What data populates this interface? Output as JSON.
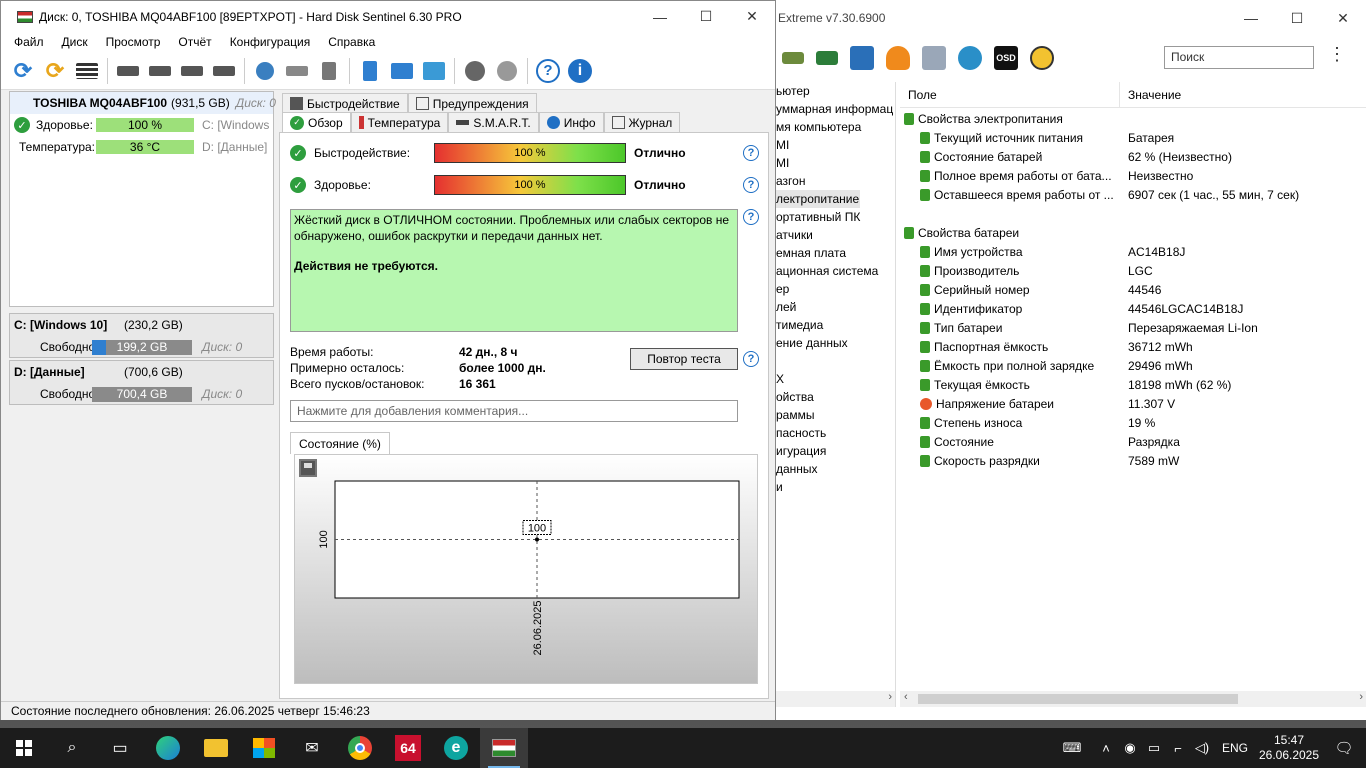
{
  "aida": {
    "title": "Extreme v7.30.6900",
    "search_placeholder": "Поиск",
    "tree": [
      "ьютер",
      "уммарная информац",
      "мя компьютера",
      "MI",
      "MI",
      "азгон",
      "лектропитание",
      "ортативный ПК",
      "атчики",
      "емная плата",
      "ационная система",
      "ер",
      "лей",
      "тимедиа",
      "ение данных",
      "",
      "X",
      "ойства",
      "раммы",
      "пасность",
      "игурация",
      "данных",
      "и"
    ],
    "selected_index": 6,
    "col_field": "Поле",
    "col_value": "Значение",
    "groups": [
      {
        "name": "Свойства электропитания",
        "rows": [
          {
            "k": "Текущий источник питания",
            "v": "Батарея"
          },
          {
            "k": "Состояние батарей",
            "v": "62 % (Неизвестно)"
          },
          {
            "k": "Полное время работы от бата...",
            "v": "Неизвестно"
          },
          {
            "k": "Оставшееся время работы от ...",
            "v": "6907 сек (1 час., 55 мин, 7 сек)"
          }
        ]
      },
      {
        "name": "Свойства батареи",
        "rows": [
          {
            "k": "Имя устройства",
            "v": "AC14B18J"
          },
          {
            "k": "Производитель",
            "v": "LGC"
          },
          {
            "k": "Серийный номер",
            "v": "44546"
          },
          {
            "k": "Идентификатор",
            "v": "44546LGCAC14B18J"
          },
          {
            "k": "Тип батареи",
            "v": "Перезаряжаемая Li-Ion"
          },
          {
            "k": "Паспортная ёмкость",
            "v": "36712 mWh"
          },
          {
            "k": "Ёмкость при полной зарядке",
            "v": "29496 mWh"
          },
          {
            "k": "Текущая ёмкость",
            "v": "18198 mWh  (62 %)"
          },
          {
            "k": "Напряжение батареи",
            "v": "11.307 V"
          },
          {
            "k": "Степень износа",
            "v": "19 %"
          },
          {
            "k": "Состояние",
            "v": "Разрядка"
          },
          {
            "k": "Скорость разрядки",
            "v": "7589 mW"
          }
        ]
      }
    ]
  },
  "hds": {
    "title": "Диск: 0, TOSHIBA MQ04ABF100 [89EPTXPOT]  -  Hard Disk Sentinel 6.30 PRO",
    "menu": [
      "Файл",
      "Диск",
      "Просмотр",
      "Отчёт",
      "Конфигурация",
      "Справка"
    ],
    "disk": {
      "name": "TOSHIBA MQ04ABF100",
      "size": "(931,5 GB)",
      "index": "Диск: 0",
      "health_label": "Здоровье:",
      "health_value": "100 %",
      "health_drive": "C: [Windows",
      "temp_label": "Температура:",
      "temp_value": "36 °C",
      "temp_drive": "D: [Данные]"
    },
    "volumes": [
      {
        "name": "C: [Windows 10]",
        "size": "(230,2 GB)",
        "free_label": "Свободно",
        "free": "199,2 GB",
        "free_fraction": 0.135,
        "disk": "Диск: 0"
      },
      {
        "name": "D: [Данные]",
        "size": "(700,6 GB)",
        "free_label": "Свободно",
        "free": "700,4 GB",
        "free_fraction": 0.0,
        "disk": "Диск: 0"
      }
    ],
    "tabs_top": [
      "Быстродействие",
      "Предупреждения"
    ],
    "tabs_bottom": [
      "Обзор",
      "Температура",
      "S.M.A.R.T.",
      "Инфо",
      "Журнал"
    ],
    "perf_label": "Быстродействие:",
    "perf_value": "100 %",
    "perf_fraction": 1.0,
    "perf_verdict": "Отлично",
    "health_label": "Здоровье:",
    "health_value": "100 %",
    "health_fraction": 1.0,
    "health_verdict": "Отлично",
    "status_text": "Жёсткий диск в ОТЛИЧНОМ состоянии. Проблемных или слабых секторов не обнаружено, ошибок раскрутки и передачи данных нет.",
    "status_action": "Действия не требуются.",
    "uptime_label": "Время работы:",
    "uptime_value": "42 дн., 8 ч",
    "remain_label": "Примерно осталось:",
    "remain_value": "более 1000 дн.",
    "starts_label": "Всего пусков/остановок:",
    "starts_value": "16 361",
    "retest_button": "Повтор теста",
    "comment_placeholder": "Нажмите для добавления комментария...",
    "chart_tab": "Состояние (%)",
    "status_bar": "Состояние последнего обновления: 26.06.2025 четверг 15:46:23"
  },
  "chart_data": {
    "type": "line",
    "x": [
      "26.06.2025"
    ],
    "series": [
      {
        "values": [
          100
        ]
      }
    ],
    "ylabel": "100",
    "point_label": "100"
  },
  "taskbar": {
    "apps": [
      "search-icon",
      "task-view-icon",
      "edge-icon",
      "explorer-icon",
      "store-icon",
      "mail-icon",
      "chrome-icon",
      "aida64-icon",
      "e-icon",
      "hds-icon"
    ],
    "aida_label": "64",
    "e_label": "e",
    "lang": "ENG",
    "time": "15:47",
    "date": "26.06.2025"
  }
}
